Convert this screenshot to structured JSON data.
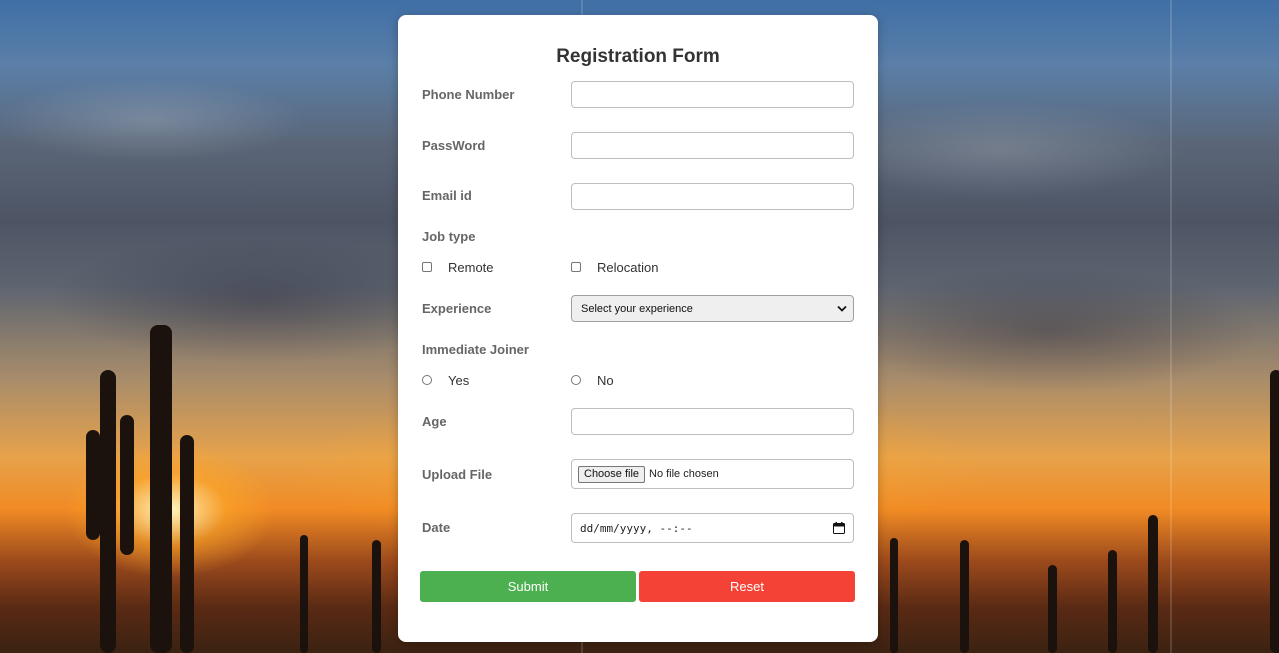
{
  "form": {
    "title": "Registration Form",
    "fields": {
      "phone": {
        "label": "Phone Number",
        "value": ""
      },
      "password": {
        "label": "PassWord",
        "value": ""
      },
      "email": {
        "label": "Email id",
        "value": ""
      },
      "age": {
        "label": "Age",
        "value": ""
      }
    },
    "job_type": {
      "label": "Job type",
      "options": [
        {
          "label": "Remote",
          "checked": false
        },
        {
          "label": "Relocation",
          "checked": false
        }
      ]
    },
    "experience": {
      "label": "Experience",
      "selected": "Select your experience"
    },
    "immediate_joiner": {
      "label": "Immediate Joiner",
      "options": [
        {
          "label": "Yes",
          "selected": false
        },
        {
          "label": "No",
          "selected": false
        }
      ]
    },
    "upload": {
      "label": "Upload File",
      "button": "Choose file",
      "status": "No file chosen"
    },
    "date": {
      "label": "Date",
      "placeholder": "dd/mm/yyyy, --:--"
    },
    "buttons": {
      "submit": "Submit",
      "reset": "Reset"
    }
  },
  "colors": {
    "submit": "#4caf50",
    "reset": "#f44336",
    "label": "#666666",
    "title": "#333333"
  },
  "icons": {
    "select_arrow": "chevron-down-icon",
    "date_picker": "calendar-icon"
  }
}
